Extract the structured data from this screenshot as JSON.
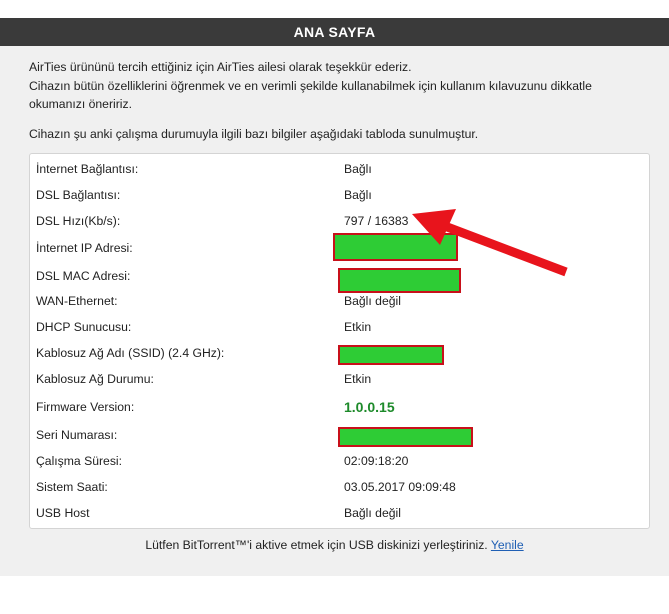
{
  "header": {
    "title": "ANA SAYFA"
  },
  "intro": {
    "line1": "AirTies ürününü tercih ettiğiniz için AirTies ailesi olarak teşekkür ederiz.",
    "line2": "Cihazın bütün özelliklerini öğrenmek ve en verimli şekilde kullanabilmek için kullanım kılavuzunu dikkatle",
    "line3": "okumanızı öneririz.",
    "line4": "Cihazın şu anki çalışma durumuyla ilgili bazı bilgiler aşağıdaki tabloda sunulmuştur."
  },
  "rows": [
    {
      "label": "İnternet Bağlantısı:",
      "value": "Bağlı"
    },
    {
      "label": "DSL Bağlantısı:",
      "value": "Bağlı"
    },
    {
      "label": "DSL Hızı(Kb/s):",
      "value": "797 / 16383"
    },
    {
      "label": "İnternet IP Adresi:",
      "value": ""
    },
    {
      "label": "DSL MAC Adresi:",
      "value": ""
    },
    {
      "label": "WAN-Ethernet:",
      "value": "Bağlı değil"
    },
    {
      "label": "DHCP Sunucusu:",
      "value": "Etkin"
    },
    {
      "label": "Kablosuz Ağ Adı (SSID) (2.4 GHz):",
      "value": ""
    },
    {
      "label": "Kablosuz Ağ Durumu:",
      "value": "Etkin"
    },
    {
      "label": "Firmware Version:",
      "value": "1.0.0.15"
    },
    {
      "label": "Seri Numarası:",
      "value": ""
    },
    {
      "label": "Çalışma Süresi:",
      "value": "02:09:18:20"
    },
    {
      "label": "Sistem Saati:",
      "value": "03.05.2017 09:09:48"
    },
    {
      "label": "USB Host",
      "value": "Bağlı değil"
    }
  ],
  "footer": {
    "text": "Lütfen BitTorrent™'i aktive etmek için USB diskinizi yerleştiriniz.",
    "link": "Yenile"
  },
  "colors": {
    "firmware": "#1d8a2a",
    "redaction_fill": "#2ecc35",
    "redaction_border": "#c8101a",
    "arrow": "#e8141c"
  }
}
